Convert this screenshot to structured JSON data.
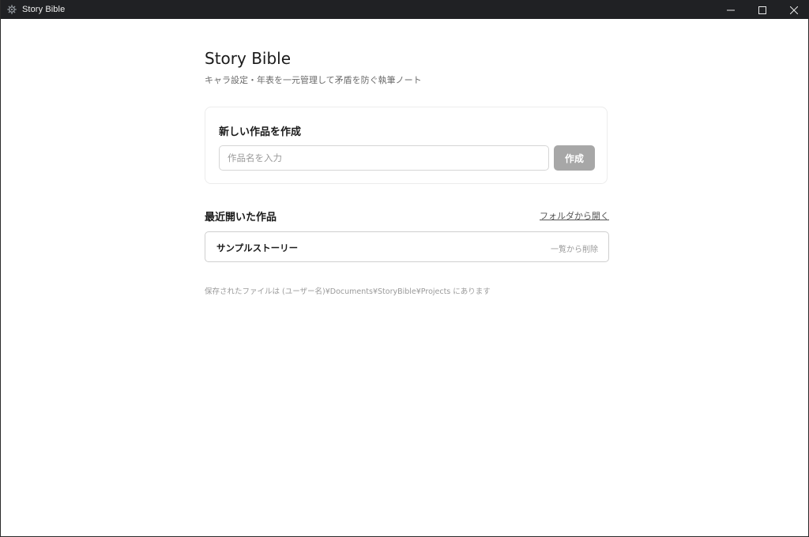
{
  "window": {
    "title": "Story Bible",
    "icons": {
      "app": "story-bible-gear-icon",
      "minimize": "minimize-icon",
      "maximize": "maximize-icon",
      "close": "close-icon"
    }
  },
  "header": {
    "title": "Story Bible",
    "subtitle": "キャラ設定・年表を一元管理して矛盾を防ぐ執筆ノート"
  },
  "create_card": {
    "title": "新しい作品を作成",
    "input_value": "",
    "input_placeholder": "作品名を入力",
    "create_label": "作成",
    "create_button_color": "#a7a7a7"
  },
  "recent": {
    "header": "最近開いた作品",
    "open_folder_label": "フォルダから開く",
    "items": [
      {
        "name": "サンプルストーリー",
        "remove_label": "一覧から削除"
      }
    ]
  },
  "footer": {
    "note": "保存されたファイルは (ユーザー名)¥Documents¥StoryBible¥Projects にあります"
  },
  "colors": {
    "titlebar_bg": "#202124",
    "background": "#ffffff",
    "text_primary": "#1a1a1a",
    "text_muted": "#9a9a9a"
  }
}
